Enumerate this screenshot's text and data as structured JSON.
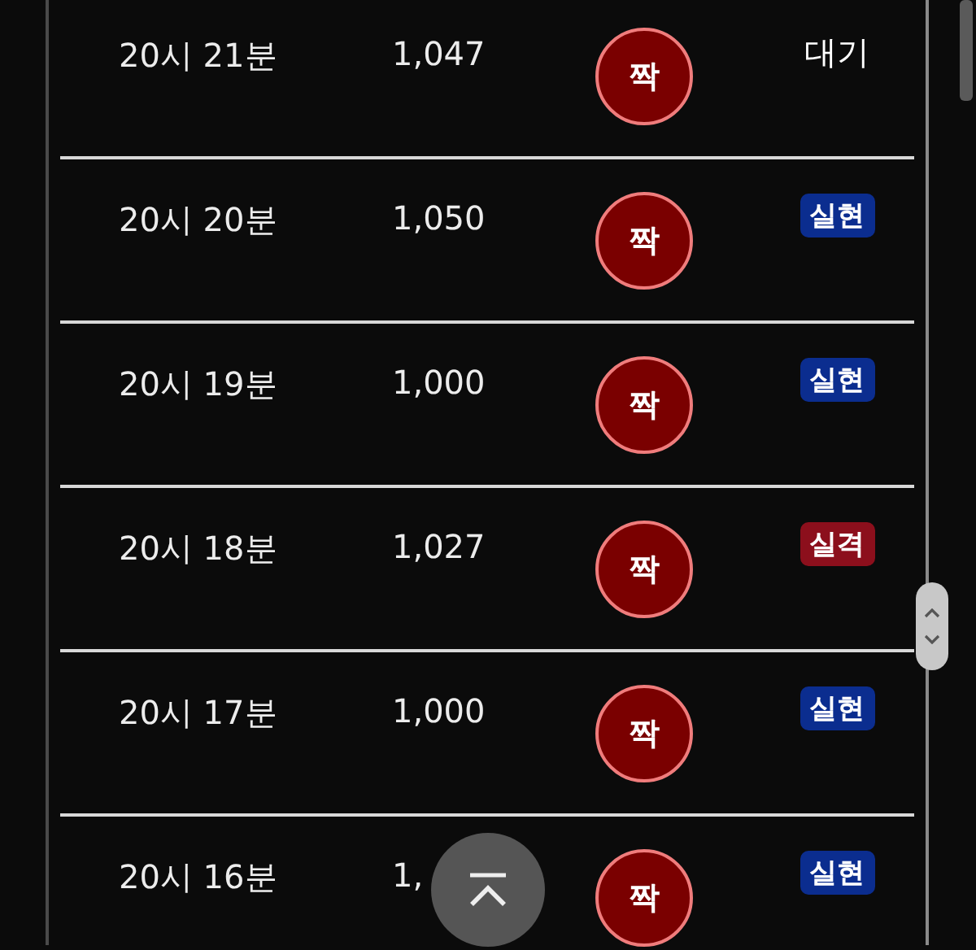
{
  "rows": [
    {
      "time": "20시 21분",
      "count": "1,047",
      "result": "짝",
      "status": {
        "kind": "pending",
        "label": "대기"
      }
    },
    {
      "time": "20시 20분",
      "count": "1,050",
      "result": "짝",
      "status": {
        "kind": "hit",
        "label": "실현"
      }
    },
    {
      "time": "20시 19분",
      "count": "1,000",
      "result": "짝",
      "status": {
        "kind": "hit",
        "label": "실현"
      }
    },
    {
      "time": "20시 18분",
      "count": "1,027",
      "result": "짝",
      "status": {
        "kind": "miss",
        "label": "실격"
      }
    },
    {
      "time": "20시 17분",
      "count": "1,000",
      "result": "짝",
      "status": {
        "kind": "hit",
        "label": "실현"
      }
    },
    {
      "time": "20시 16분",
      "count": "1,",
      "result": "짝",
      "status": {
        "kind": "hit",
        "label": "실현"
      }
    }
  ]
}
